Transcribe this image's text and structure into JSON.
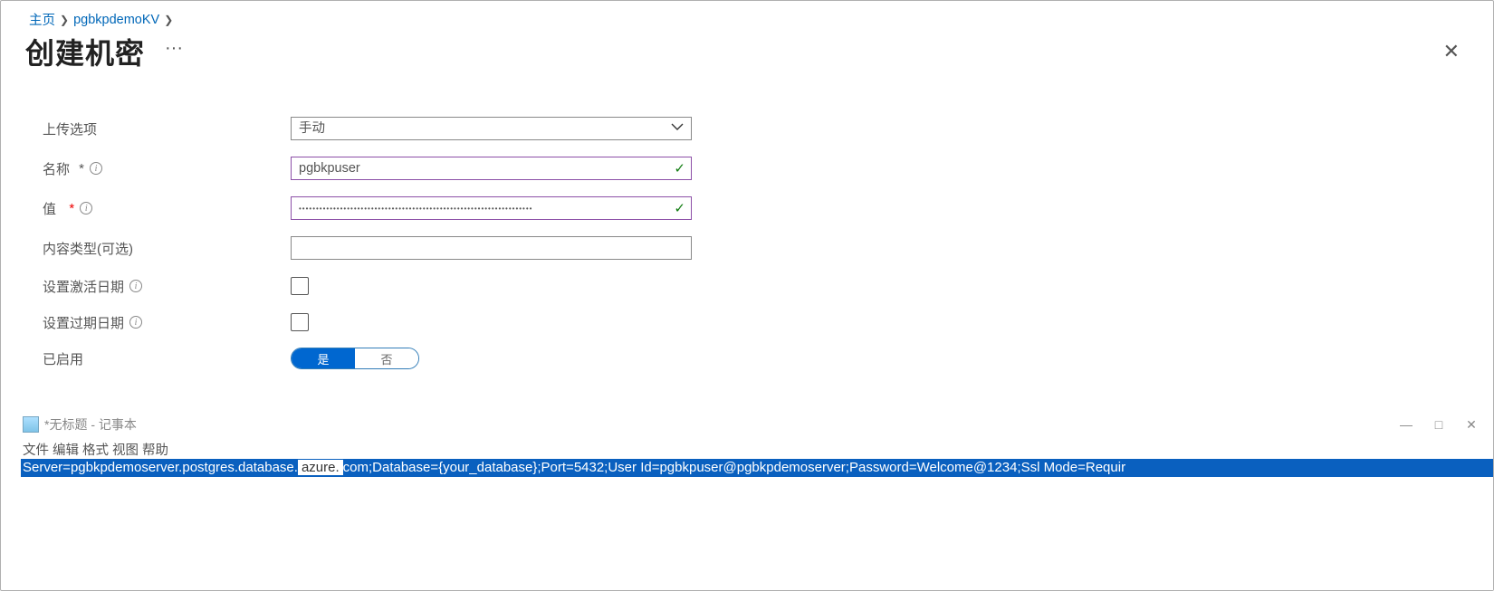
{
  "breadcrumb": {
    "home": "主页",
    "kv": "pgbkpdemoKV"
  },
  "page_title": "创建机密",
  "form": {
    "upload_label": "上传选项",
    "upload_value": "手动",
    "name_label": "名称",
    "name_value": "pgbkpuser",
    "value_label": "值",
    "value_value": "••••••••••••••••••••••••••••••••••••••••••••••••••••••••••••••••••••",
    "content_type_label": "内容类型(可选)",
    "content_type_value": "",
    "activation_label": "设置激活日期",
    "expiration_label": "设置过期日期",
    "enabled_label": "已启用",
    "toggle_yes": "是",
    "toggle_no": "否"
  },
  "notepad": {
    "title": "*无标题 - 记事本",
    "menu": {
      "file": "文件",
      "edit": "编辑",
      "format": "格式",
      "view": "视图",
      "help": "帮助"
    },
    "seg1": "Server=pgbkpdemoserver.postgres.database.",
    "seg_gap": "azure.",
    "seg2": "com;Database={your_database};Port=5432;User Id=pgbkpuser@pgbkpdemoserver;Password=Welcome@1234;Ssl Mode=Requir"
  }
}
